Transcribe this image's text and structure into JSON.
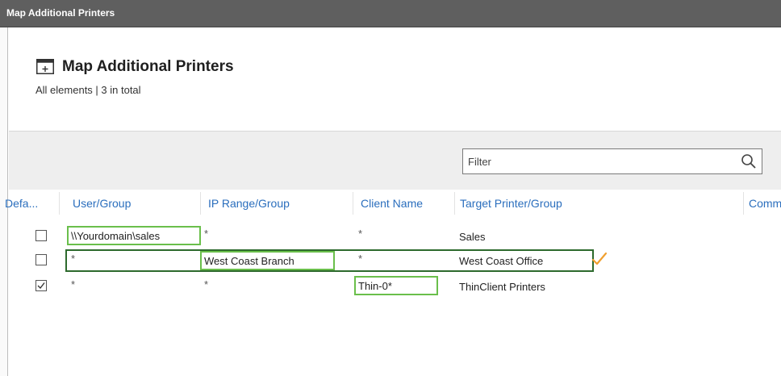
{
  "window": {
    "title": "Map Additional Printers"
  },
  "header": {
    "title": "Map Additional Printers",
    "subtitle": "All elements | 3 in total"
  },
  "filter": {
    "placeholder": "Filter"
  },
  "columns": [
    "Defa...",
    "User/Group",
    "IP Range/Group",
    "Client Name",
    "Target Printer/Group",
    "Comm"
  ],
  "rows": [
    {
      "default": false,
      "user_group": "\\\\Yourdomain\\sales",
      "ip_range": "*",
      "client_name": "*",
      "target": "Sales"
    },
    {
      "default": false,
      "user_group": "*",
      "ip_range": "West Coast Branch",
      "client_name": "*",
      "target": "West Coast Office"
    },
    {
      "default": true,
      "user_group": "*",
      "ip_range": "*",
      "client_name": "Thin-0*",
      "target": "ThinClient Printers"
    }
  ],
  "colors": {
    "accent": "#2a6ebd",
    "highlight": "#6abf4b",
    "row_highlight": "#2d6a2d",
    "checkmark": "#f0a030"
  },
  "icons": {
    "header": "add-window-icon",
    "filter": "search-icon",
    "status": "checkmark-icon"
  }
}
